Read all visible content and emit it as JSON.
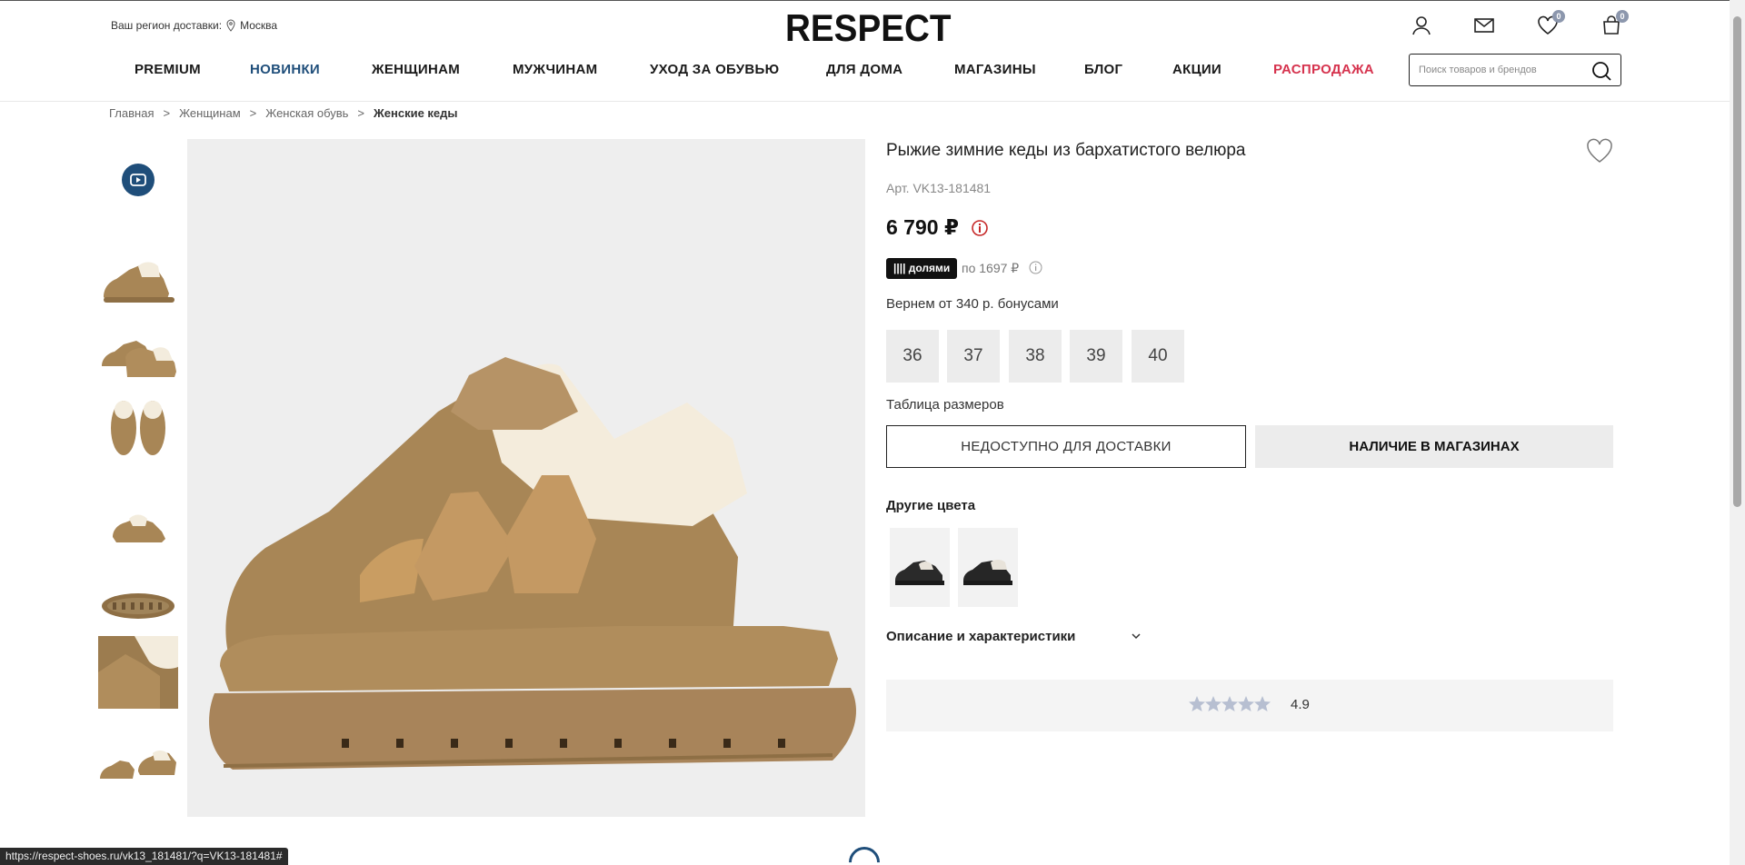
{
  "header": {
    "region_label": "Ваш регион доставки:",
    "region_city": "Москва",
    "logo": "RESPECT",
    "favorites_count": "0",
    "cart_count": "0"
  },
  "nav": {
    "items": [
      "PREMIUM",
      "НОВИНКИ",
      "ЖЕНЩИНАМ",
      "МУЖЧИНАМ",
      "УХОД ЗА ОБУВЬЮ",
      "ДЛЯ ДОМА",
      "МАГАЗИНЫ",
      "БЛОГ",
      "АКЦИИ",
      "РАСПРОДАЖА"
    ],
    "search_placeholder": "Поиск товаров и брендов"
  },
  "breadcrumb": {
    "items": [
      "Главная",
      "Женщинам",
      "Женская обувь"
    ],
    "current": "Женские кеды",
    "separator": ">"
  },
  "product": {
    "title": "Рыжие зимние кеды из бархатистого велюра",
    "article": "Арт. VK13-181481",
    "price": "6 790 ₽",
    "dolyami_badge": "|||| долями",
    "dolyami_text": "по 1697 ₽",
    "bonus": "Вернем от 340 р. бонусами",
    "sizes": [
      "36",
      "37",
      "38",
      "39",
      "40"
    ],
    "size_table": "Таблица размеров",
    "btn_unavailable": "НЕДОСТУПНО ДЛЯ ДОСТАВКИ",
    "btn_stores": "НАЛИЧИЕ В МАГАЗИНАХ",
    "other_colors": "Другие цвета",
    "description": "Описание и характеристики",
    "rating": "4.9"
  },
  "statusbar": {
    "url": "https://respect-shoes.ru/vk13_181481/?q=VK13-181481#"
  },
  "colors": {
    "accent_blue": "#1f4e7a",
    "sale_red": "#d6334e",
    "shoe_tan": "#a88656",
    "badge_grey": "#8c97ad"
  }
}
